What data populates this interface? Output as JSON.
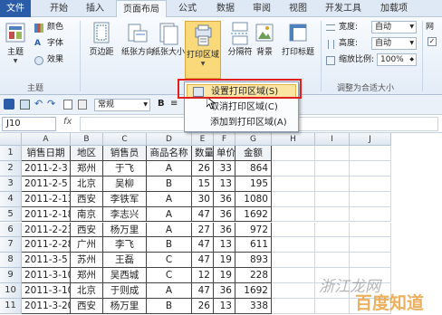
{
  "tabs": [
    {
      "label": "文件"
    },
    {
      "label": "开始"
    },
    {
      "label": "插入"
    },
    {
      "label": "页面布局"
    },
    {
      "label": "公式"
    },
    {
      "label": "数据"
    },
    {
      "label": "审阅"
    },
    {
      "label": "视图"
    },
    {
      "label": "开发工具"
    },
    {
      "label": "加载项"
    }
  ],
  "ribbon": {
    "theme": {
      "label": "主题",
      "colors": "颜色",
      "fonts": "字体",
      "effects": "效果",
      "group": "主题"
    },
    "margins": "页边距",
    "orientation": "纸张方向",
    "size": "纸张大小",
    "print_area": "打印区域",
    "breaks": "分隔符",
    "background": "背景",
    "print_titles": "打印标题",
    "width_label": "宽度:",
    "width_value": "自动",
    "height_label": "高度:",
    "height_value": "自动",
    "scale_label": "缩放比例:",
    "scale_value": "100%",
    "fit_group": "调整为合适大小",
    "sheet_options": "网",
    "sheet_check": "✓"
  },
  "menu": {
    "items": [
      {
        "label": "设置打印区域(S)"
      },
      {
        "label": "取消打印区域(C)"
      },
      {
        "label": "添加到打印区域(A)"
      }
    ]
  },
  "qat": {
    "style_value": "常规"
  },
  "formula": {
    "name_box": "J10",
    "fx": "fx"
  },
  "columns": [
    "A",
    "B",
    "C",
    "D",
    "E",
    "F",
    "G",
    "H",
    "I",
    "J"
  ],
  "table": {
    "headers": [
      "销售日期",
      "地区",
      "销售员",
      "商品名称",
      "数量",
      "单价",
      "金额"
    ],
    "rows": [
      [
        "2011-2-3",
        "郑州",
        "于飞",
        "A",
        "26",
        "33",
        "864"
      ],
      [
        "2011-2-5",
        "北京",
        "吴柳",
        "B",
        "15",
        "13",
        "195"
      ],
      [
        "2011-2-13",
        "西安",
        "李铁军",
        "A",
        "30",
        "36",
        "1080"
      ],
      [
        "2011-2-18",
        "南京",
        "李志兴",
        "A",
        "47",
        "36",
        "1692"
      ],
      [
        "2011-2-23",
        "西安",
        "杨万里",
        "A",
        "27",
        "36",
        "972"
      ],
      [
        "2011-2-28",
        "广州",
        "李飞",
        "B",
        "47",
        "13",
        "611"
      ],
      [
        "2011-3-5",
        "苏州",
        "王磊",
        "C",
        "47",
        "19",
        "893"
      ],
      [
        "2011-3-10",
        "郑州",
        "吴西城",
        "C",
        "12",
        "19",
        "228"
      ],
      [
        "2011-3-10",
        "北京",
        "于则成",
        "A",
        "47",
        "36",
        "1692"
      ],
      [
        "2011-3-20",
        "西安",
        "杨万里",
        "B",
        "26",
        "13",
        "338"
      ]
    ]
  },
  "watermark": {
    "line1": "浙江龙网",
    "line2": "百度知道"
  }
}
